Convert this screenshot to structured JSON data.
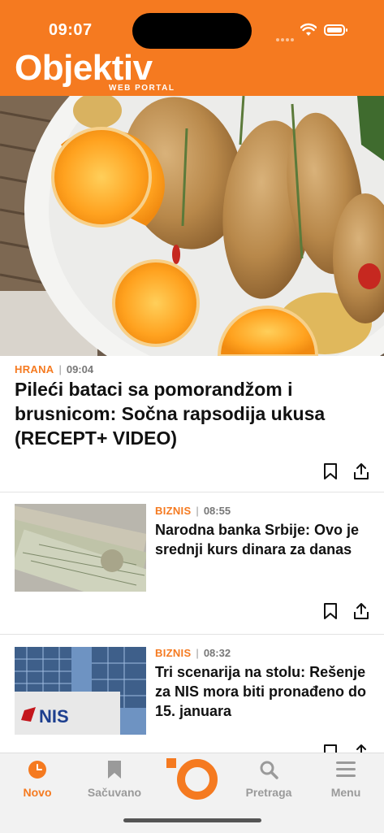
{
  "status_bar": {
    "time": "09:07"
  },
  "header": {
    "logo_text": "Objektiv",
    "logo_sub": "WEB PORTAL",
    "brand_color": "#F57A20"
  },
  "hero": {
    "category": "HRANA",
    "time": "09:04",
    "title": "Pileći bataci sa pomorandžom i brusnicom: Sočna rapsodija ukusa (RECEPT+ VIDEO)"
  },
  "articles": [
    {
      "category": "BIZNIS",
      "time": "08:55",
      "title": "Narodna banka Srbije: Ovo je srednji kurs dinara za danas"
    },
    {
      "category": "BIZNIS",
      "time": "08:32",
      "title": "Tri scenarija na stolu: Rešenje za NIS mora biti pronađeno do 15. januara"
    }
  ],
  "tabbar": {
    "items": [
      {
        "label": "Novo",
        "icon": "clock-icon",
        "active": true
      },
      {
        "label": "Sačuvano",
        "icon": "bookmark-icon",
        "active": false
      },
      {
        "label": "",
        "icon": "objektiv-logo-icon",
        "active": false
      },
      {
        "label": "Pretraga",
        "icon": "search-icon",
        "active": false
      },
      {
        "label": "Menu",
        "icon": "menu-icon",
        "active": false
      }
    ]
  }
}
